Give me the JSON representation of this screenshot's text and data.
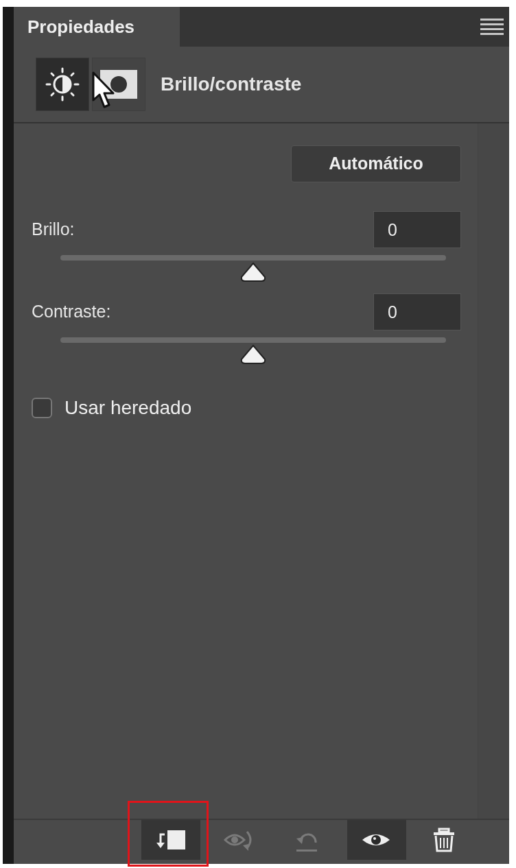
{
  "panel": {
    "tab": "Propiedades",
    "menu": true
  },
  "header": {
    "modes": [
      {
        "kind": "adjustment",
        "selected": true
      },
      {
        "kind": "mask",
        "selected": false
      }
    ],
    "title": "Brillo/contraste"
  },
  "auto_button": "Automático",
  "sliders": [
    {
      "label": "Brillo:",
      "value": "0",
      "level": 0.5
    },
    {
      "label": "Contraste:",
      "value": "0",
      "level": 0.5
    }
  ],
  "legacy": {
    "label": "Usar heredado",
    "checked": false
  },
  "footer": [
    {
      "kind": "clip",
      "selected": true,
      "disabled": false,
      "highlighted": true
    },
    {
      "kind": "view-previous",
      "selected": false,
      "disabled": true,
      "highlighted": false
    },
    {
      "kind": "reset",
      "selected": false,
      "disabled": true,
      "highlighted": false
    },
    {
      "kind": "visibility",
      "selected": true,
      "disabled": false,
      "highlighted": false
    },
    {
      "kind": "delete",
      "selected": false,
      "disabled": false,
      "highlighted": false
    }
  ]
}
